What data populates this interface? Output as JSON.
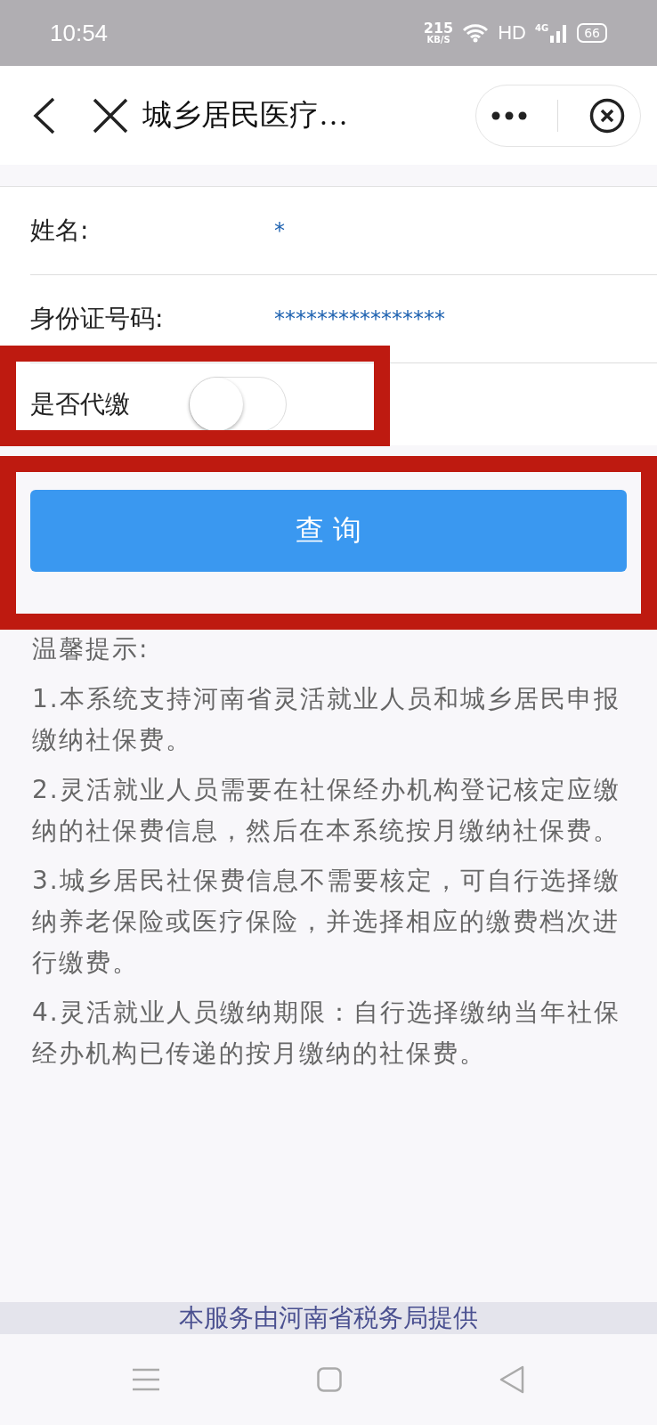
{
  "status_bar": {
    "time": "10:54",
    "speed_value": "215",
    "speed_unit": "KB/S",
    "network": "HD",
    "cellular": "4G",
    "battery": "66"
  },
  "nav": {
    "title": "城乡居民医疗…"
  },
  "form": {
    "fields": [
      {
        "label": "姓名:",
        "value": "*"
      },
      {
        "label": "身份证号码:",
        "value": "****************"
      }
    ],
    "toggle": {
      "label": "是否代缴",
      "on": false
    },
    "button": "查 询"
  },
  "tips": {
    "title": "温馨提示:",
    "items": [
      "1.本系统支持河南省灵活就业人员和城乡居民申报缴纳社保费。",
      "2.灵活就业人员需要在社保经办机构登记核定应缴纳的社保费信息，然后在本系统按月缴纳社保费。",
      "3.城乡居民社保费信息不需要核定，可自行选择缴纳养老保险或医疗保险，并选择相应的缴费档次进行缴费。",
      "4.灵活就业人员缴纳期限：自行选择缴纳当年社保经办机构已传递的按月缴纳的社保费。"
    ]
  },
  "footer": "本服务由河南省税务局提供"
}
